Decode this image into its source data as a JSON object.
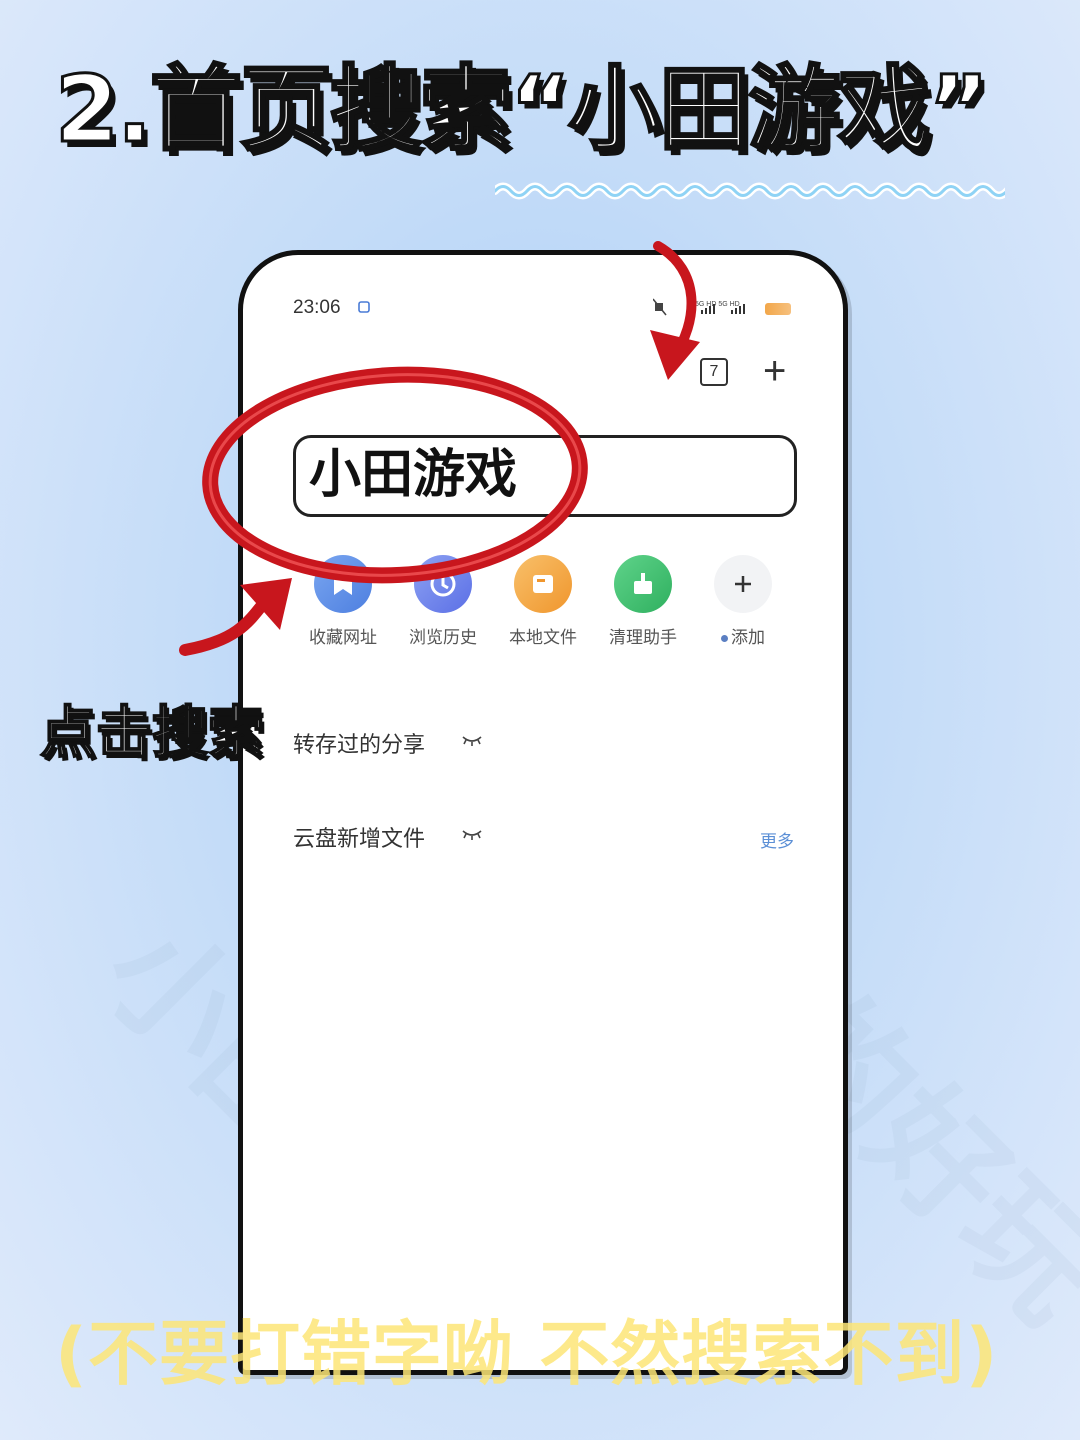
{
  "headline": "2.首页搜索“小田游戏”",
  "status_bar": {
    "time": "23:06",
    "network": "5G HD 5G HD"
  },
  "toolbar": {
    "tab_count": "7",
    "new_tab_symbol": "+"
  },
  "search": {
    "value": "小田游戏"
  },
  "shortcuts": [
    {
      "label": "收藏网址",
      "icon": "bookmark-icon",
      "color": "#5b8de6"
    },
    {
      "label": "浏览历史",
      "icon": "history-icon",
      "color": "#6a7ee8"
    },
    {
      "label": "本地文件",
      "icon": "folder-icon",
      "color": "#f3a33b"
    },
    {
      "label": "清理助手",
      "icon": "broom-icon",
      "color": "#3dbd6a"
    },
    {
      "label": "添加",
      "icon": "plus-icon",
      "color": "#f2f3f5"
    }
  ],
  "sections": {
    "shared_saved": "转存过的分享",
    "cloud_new": "云盘新增文件",
    "more_label": "更多"
  },
  "annotations": {
    "side_note": "点击搜索",
    "bottom_note": "(不要打错字呦 不然搜索不到)"
  },
  "watermarks": [
    "小田游戏",
    "真的好玩"
  ],
  "colors": {
    "annotation_red": "#c8161d",
    "bottom_note_yellow": "#fde677",
    "link_blue": "#5b8fd6"
  }
}
